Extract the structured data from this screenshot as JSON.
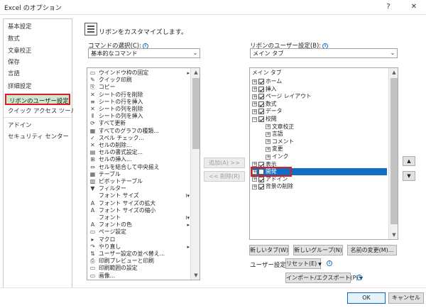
{
  "window": {
    "title": "Excel のオプション",
    "help": "?",
    "close": "✕"
  },
  "nav": {
    "items": [
      {
        "label": "基本設定"
      },
      {
        "label": "数式"
      },
      {
        "label": "文章校正"
      },
      {
        "label": "保存"
      },
      {
        "label": "言語"
      },
      {
        "label": "詳細設定"
      },
      {
        "label": "リボンのユーザー設定",
        "selected": true
      },
      {
        "label": "クイック アクセス ツール バー"
      },
      {
        "label": "アドイン"
      },
      {
        "label": "セキュリティ センター"
      }
    ]
  },
  "main": {
    "headline": "リボンをカスタマイズします。",
    "commands_label": "コマンドの選択(C):",
    "commands_value": "基本的なコマンド",
    "ribbon_label": "リボンのユーザー設定(B):",
    "ribbon_value": "メイン タブ"
  },
  "commands": [
    {
      "icon": "▭",
      "label": "ウインドウ枠の固定",
      "right": "▸"
    },
    {
      "icon": "✎",
      "label": "クイック印刷"
    },
    {
      "icon": "⎘",
      "label": "コピー"
    },
    {
      "icon": "✕",
      "label": "シートの行を削除"
    },
    {
      "icon": "≡",
      "label": "シートの行を挿入"
    },
    {
      "icon": "✕",
      "label": "シートの列を削除"
    },
    {
      "icon": "⫴",
      "label": "シートの列を挿入"
    },
    {
      "icon": "⟳",
      "label": "すべて更新"
    },
    {
      "icon": "▦",
      "label": "すべてのグラフの種類..."
    },
    {
      "icon": "✓",
      "label": "スペル チェック..."
    },
    {
      "icon": "✕",
      "label": "セルの削除..."
    },
    {
      "icon": "▤",
      "label": "セルの書式設定..."
    },
    {
      "icon": "⊞",
      "label": "セルの挿入..."
    },
    {
      "icon": "⇔",
      "label": "セルを結合して中央揃え"
    },
    {
      "icon": "▦",
      "label": "テーブル"
    },
    {
      "icon": "▥",
      "label": "ピボットテーブル"
    },
    {
      "icon": "▼",
      "label": "フィルター"
    },
    {
      "icon": "",
      "label": "フォント サイズ",
      "right": "I▾"
    },
    {
      "icon": "A",
      "label": "フォント サイズの拡大"
    },
    {
      "icon": "A",
      "label": "フォント サイズの縮小"
    },
    {
      "icon": "",
      "label": "フォント",
      "right": "I▾"
    },
    {
      "icon": "A",
      "label": "フォントの色",
      "right": "▸"
    },
    {
      "icon": "▭",
      "label": "ページ設定"
    },
    {
      "icon": "▸",
      "label": "マクロ"
    },
    {
      "icon": "↷",
      "label": "やり直し",
      "right": "▸"
    },
    {
      "icon": "⇅",
      "label": "ユーザー設定の並べ替え..."
    },
    {
      "icon": "⎙",
      "label": "印刷プレビューと印刷"
    },
    {
      "icon": "▭",
      "label": "印刷範囲の設定"
    },
    {
      "icon": "▭",
      "label": "画像..."
    }
  ],
  "tree": {
    "header": "メイン タブ",
    "items": [
      {
        "label": "ホーム",
        "level": 1,
        "exp": "+",
        "checked": true
      },
      {
        "label": "挿入",
        "level": 1,
        "exp": "+",
        "checked": true
      },
      {
        "label": "ページ レイアウト",
        "level": 1,
        "exp": "+",
        "checked": true
      },
      {
        "label": "数式",
        "level": 1,
        "exp": "+",
        "checked": true
      },
      {
        "label": "データ",
        "level": 1,
        "exp": "+",
        "checked": true
      },
      {
        "label": "校閲",
        "level": 1,
        "exp": "−",
        "checked": true
      },
      {
        "label": "文章校正",
        "level": 2,
        "exp": "+"
      },
      {
        "label": "言語",
        "level": 2,
        "exp": "+"
      },
      {
        "label": "コメント",
        "level": 2,
        "exp": "+"
      },
      {
        "label": "変更",
        "level": 2,
        "exp": "+"
      },
      {
        "label": "インク",
        "level": 2,
        "exp": "+"
      },
      {
        "label": "表示",
        "level": 1,
        "exp": "+",
        "checked": true
      },
      {
        "label": "開発",
        "level": 1,
        "exp": "+",
        "checked": false,
        "selected": true
      },
      {
        "label": "アドイン",
        "level": 1,
        "exp": "+",
        "checked": true
      },
      {
        "label": "背景の削除",
        "level": 1,
        "exp": "+",
        "checked": true
      }
    ]
  },
  "buttons": {
    "add": "追加(A) >>",
    "remove": "<< 削除(R)",
    "new_tab": "新しいタブ(W)",
    "new_group": "新しいグループ(N)",
    "rename": "名前の変更(M)...",
    "custom_label": "ユーザー設定:",
    "reset": "リセット(E)",
    "import_export": "インポート/エクスポート(P)",
    "ok": "OK",
    "cancel": "キャンセル",
    "info": "i",
    "up": "▲",
    "down": "▼"
  }
}
